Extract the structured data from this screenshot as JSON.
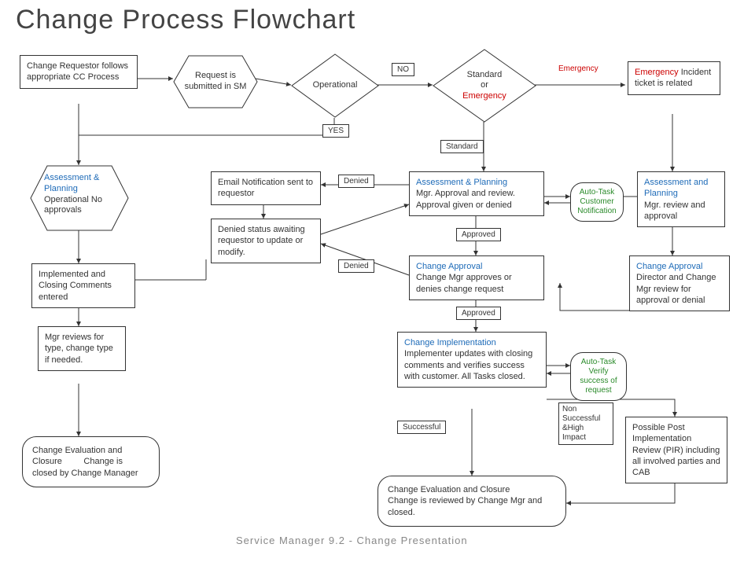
{
  "title": "Change Process Flowchart",
  "footer": "Service Manager 9.2 - Change Presentation",
  "nodes": {
    "requestor": "Change Requestor follows appropriate CC Process",
    "submitted": "Request is submitted in SM",
    "operational": "Operational",
    "std_or_emerg_l1": "Standard",
    "std_or_emerg_l2": "or",
    "std_or_emerg_l3": "Emergency",
    "emergency_label": "Emergency",
    "emerg_incident": "Emergency Incident ticket is related",
    "no": "NO",
    "yes": "YES",
    "standard": "Standard",
    "assess_op_title": "Assessment & Planning",
    "assess_op_body": "Operational No approvals",
    "assess_plan_title": "Assessment & Planning",
    "assess_plan_body": "Mgr. Approval and review. Approval given or denied",
    "assess_emerg_title": "Assessment and Planning",
    "assess_emerg_body": "Mgr. review and approval",
    "email_notify": "Email Notification sent to requestor",
    "denied_status": "Denied status awaiting requestor to update or modify.",
    "denied": "Denied",
    "approved": "Approved",
    "autotask_cust": "Auto-Task Customer Notification",
    "change_approval_title": "Change Approval",
    "change_approval_body": "Change Mgr approves or denies change request",
    "change_approval_dir_title": "Change Approval",
    "change_approval_dir_body": "Director and Change Mgr review for approval or denial",
    "implemented": "Implemented and Closing Comments entered",
    "mgr_reviews": "Mgr reviews for type, change type if needed.",
    "change_impl_title": "Change Implementation",
    "change_impl_body": "Implementer updates with closing comments and verifies success with customer. All Tasks closed.",
    "autotask_verify": "Auto-Task Verify success of request",
    "successful": "Successful",
    "non_successful": "Non Successful &High Impact",
    "pir": "Possible Post Implementation Review (PIR) including all involved parties and CAB",
    "eval_closure_title": "Change Evaluation and Closure",
    "eval_closure_body": "Change is closed by Change Manager",
    "eval_closure2_title": "Change Evaluation and Closure",
    "eval_closure2_body": "Change is reviewed by Change Mgr and closed.",
    "emerg_top": "Emergency"
  }
}
